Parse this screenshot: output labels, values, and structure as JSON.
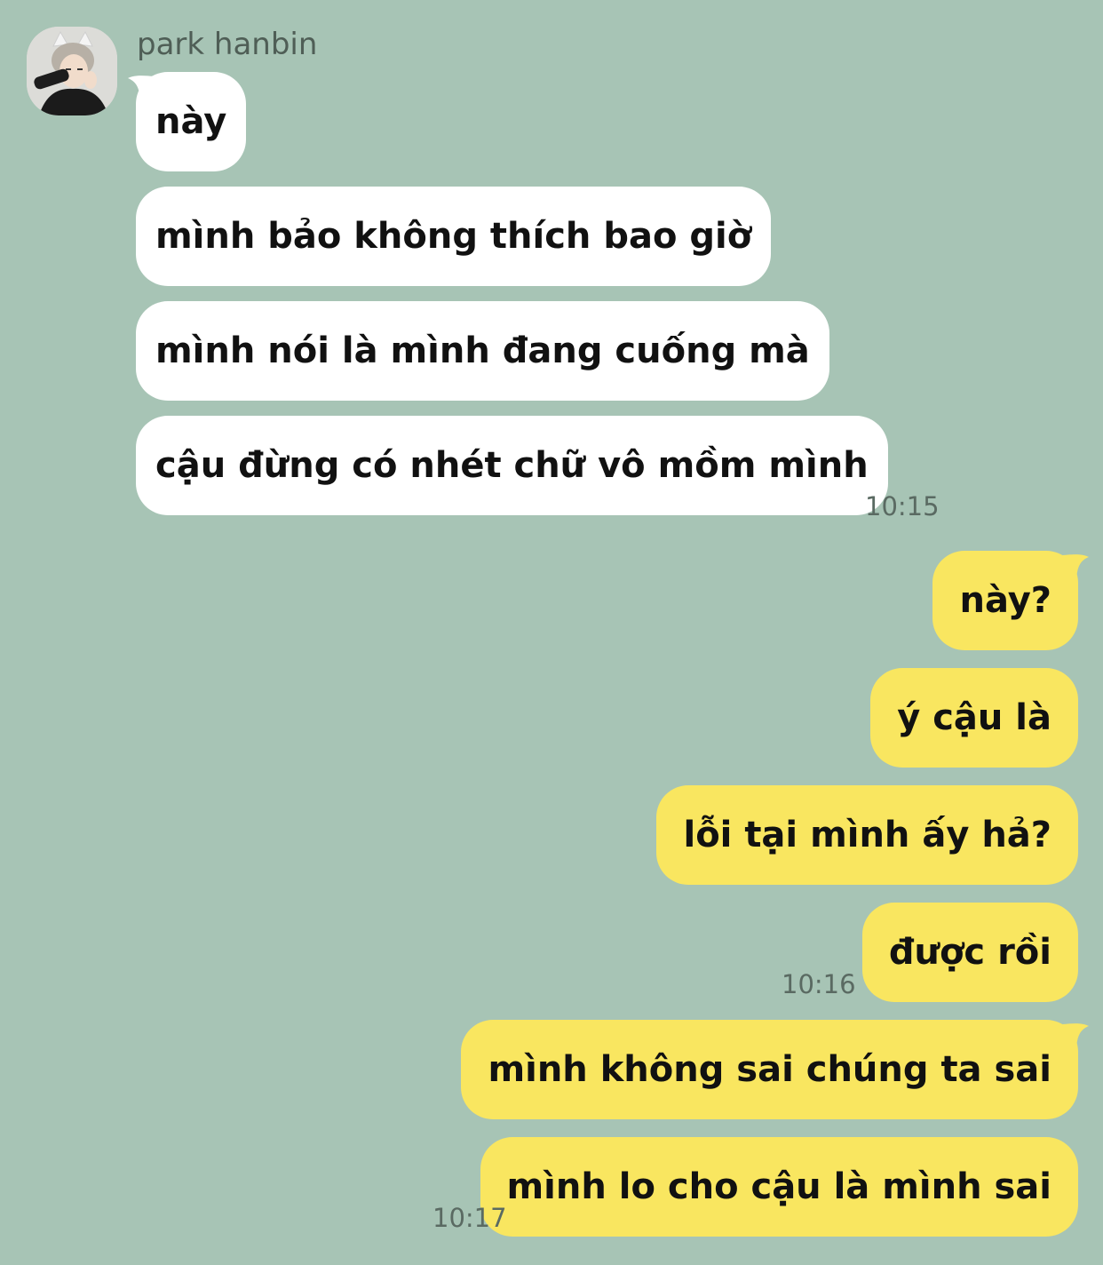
{
  "contact": {
    "name": "park hanbin"
  },
  "incoming": [
    "này",
    "mình bảo không thích bao giờ",
    "mình nói là mình đang cuống mà",
    "cậu đừng có nhét chữ vô mồm mình"
  ],
  "incoming_time": "10:15",
  "outgoing": [
    "này?",
    "ý cậu là",
    "lỗi tại mình ấy hả?",
    "được rồi",
    "mình không sai chúng ta sai",
    "mình lo cho cậu là mình sai"
  ],
  "outgoing_times": [
    "10:16",
    "10:17"
  ],
  "colors": {
    "background": "#a7c4b5",
    "incoming_bubble": "#ffffff",
    "outgoing_bubble": "#f9e660"
  }
}
